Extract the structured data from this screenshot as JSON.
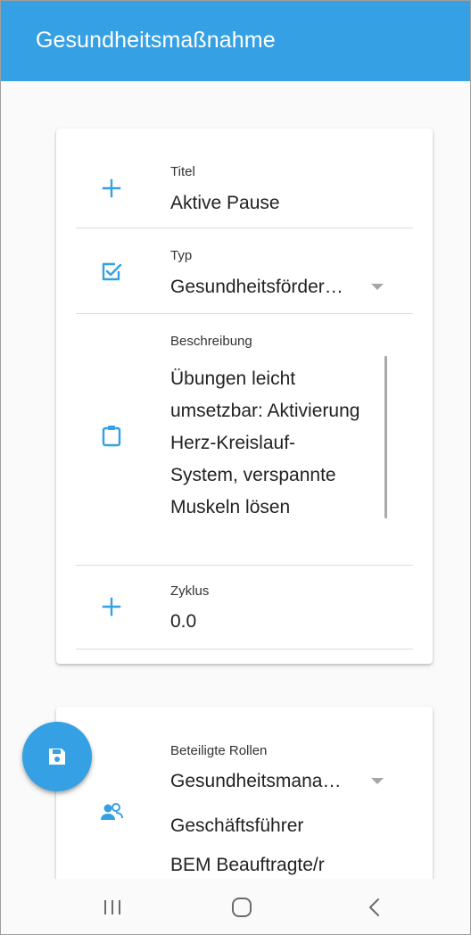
{
  "appbar": {
    "title": "Gesundheitsmaßnahme"
  },
  "card1": {
    "title_field": {
      "label": "Titel",
      "value": "Aktive Pause",
      "icon": "plus-icon"
    },
    "type_field": {
      "label": "Typ",
      "value": "Gesundheitsförder…",
      "icon": "checkbox-icon"
    },
    "description_field": {
      "label": "Beschreibung",
      "value": "Übungen leicht umsetzbar: Aktivierung Herz-Kreislauf-System, verspannte Muskeln lösen",
      "icon": "clipboard-icon"
    },
    "cycle_field": {
      "label": "Zyklus",
      "value": "0.0",
      "icon": "plus-icon"
    }
  },
  "card2": {
    "roles_field": {
      "label": "Beteiligte Rollen",
      "selected": "Gesundheitsmana…",
      "icon": "people-icon",
      "items": [
        "Geschäftsführer",
        "BEM Beauftragte/r"
      ]
    }
  },
  "fab": {
    "icon": "save-icon"
  },
  "navbar": {
    "icons": [
      "recent-apps-icon",
      "home-icon",
      "back-icon"
    ]
  },
  "colors": {
    "primary": "#35a0e3",
    "background": "#fafafa",
    "card": "#ffffff"
  }
}
